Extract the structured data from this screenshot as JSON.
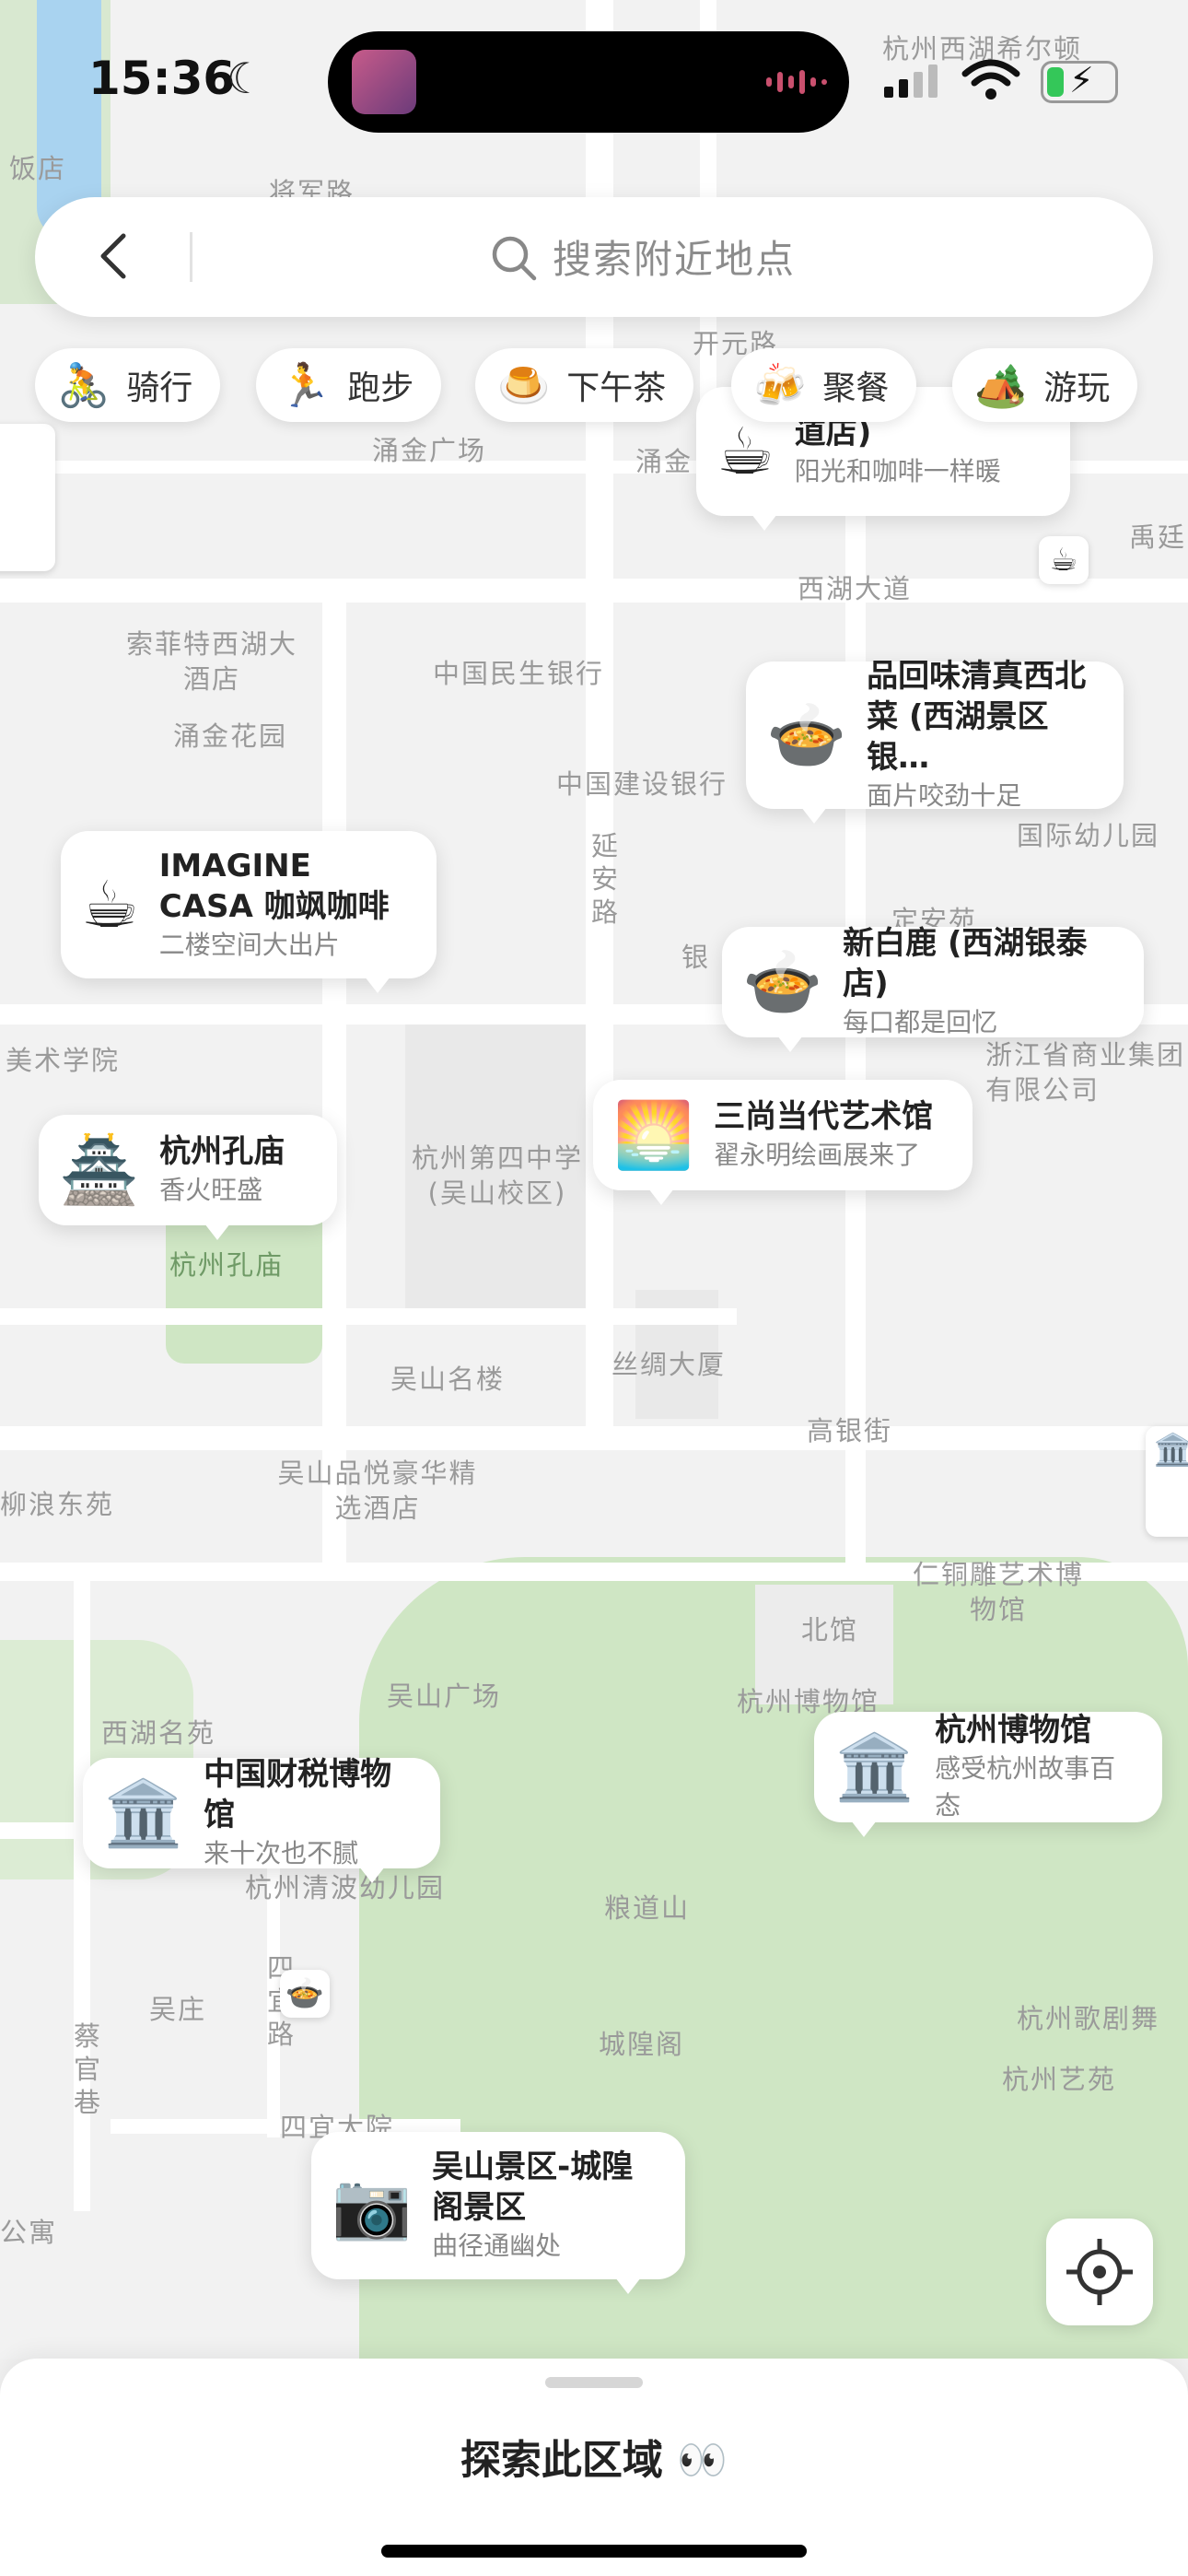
{
  "status_bar": {
    "time": "15:36"
  },
  "search": {
    "placeholder": "搜索附近地点"
  },
  "categories": [
    {
      "emoji": "🚴",
      "label": "骑行"
    },
    {
      "emoji": "🏃",
      "label": "跑步"
    },
    {
      "emoji": "🍮",
      "label": "下午茶"
    },
    {
      "emoji": "🍻",
      "label": "聚餐"
    },
    {
      "emoji": "🏕️",
      "label": "游玩"
    }
  ],
  "pois": [
    {
      "icon": "☕",
      "title": "道店)",
      "subtitle": "阳光和咖啡一样暖"
    },
    {
      "icon": "🍲",
      "title": "品回味清真西北菜 (西湖景区银…",
      "subtitle": "面片咬劲十足"
    },
    {
      "icon": "☕",
      "title": "IMAGINE CASA 咖飒咖啡",
      "subtitle": "二楼空间大出片"
    },
    {
      "icon": "🍲",
      "title": "新白鹿 (西湖银泰店)",
      "subtitle": "每口都是回忆"
    },
    {
      "icon": "🌅",
      "title": "三尚当代艺术馆",
      "subtitle": "翟永明绘画展来了"
    },
    {
      "icon": "🏯",
      "title": "杭州孔庙",
      "subtitle": "香火旺盛"
    },
    {
      "icon": "🏛️",
      "title": "杭州博物馆",
      "subtitle": "感受杭州故事百态"
    },
    {
      "icon": "🏛️",
      "title": "中国财税博物馆",
      "subtitle": "来十次也不腻"
    },
    {
      "icon": "📷",
      "title": "吴山景区-城隍阁景区",
      "subtitle": "曲径通幽处"
    }
  ],
  "map_labels": [
    "杭州西湖希尔顿",
    "饭店",
    "将军路",
    "开元路",
    "涌金广场",
    "涌金",
    "西湖大道",
    "禹廷",
    "索菲特西湖大酒店",
    "涌金花园",
    "中国民生银行",
    "中国建设银行",
    "延安路",
    "定安苑",
    "国际幼儿园",
    "浙江省商业集团有限公司",
    "美术学院",
    "杭州第四中学 (吴山校区)",
    "杭州孔庙",
    "吴山名楼",
    "丝绸大厦",
    "高银街",
    "柳浪东苑",
    "吴山品悦豪华精选酒店",
    "仁铜雕艺术博物馆",
    "北馆",
    "杭州博物馆",
    "吴山广场",
    "西湖名苑",
    "杭州清波幼儿园",
    "粮道山",
    "城隍阁",
    "吴庄",
    "四宜路",
    "蔡官巷",
    "四宜大院",
    "杭州歌剧舞",
    "杭州艺苑",
    "公寓",
    "银"
  ],
  "sheet": {
    "title": "探索此区域 👀"
  }
}
